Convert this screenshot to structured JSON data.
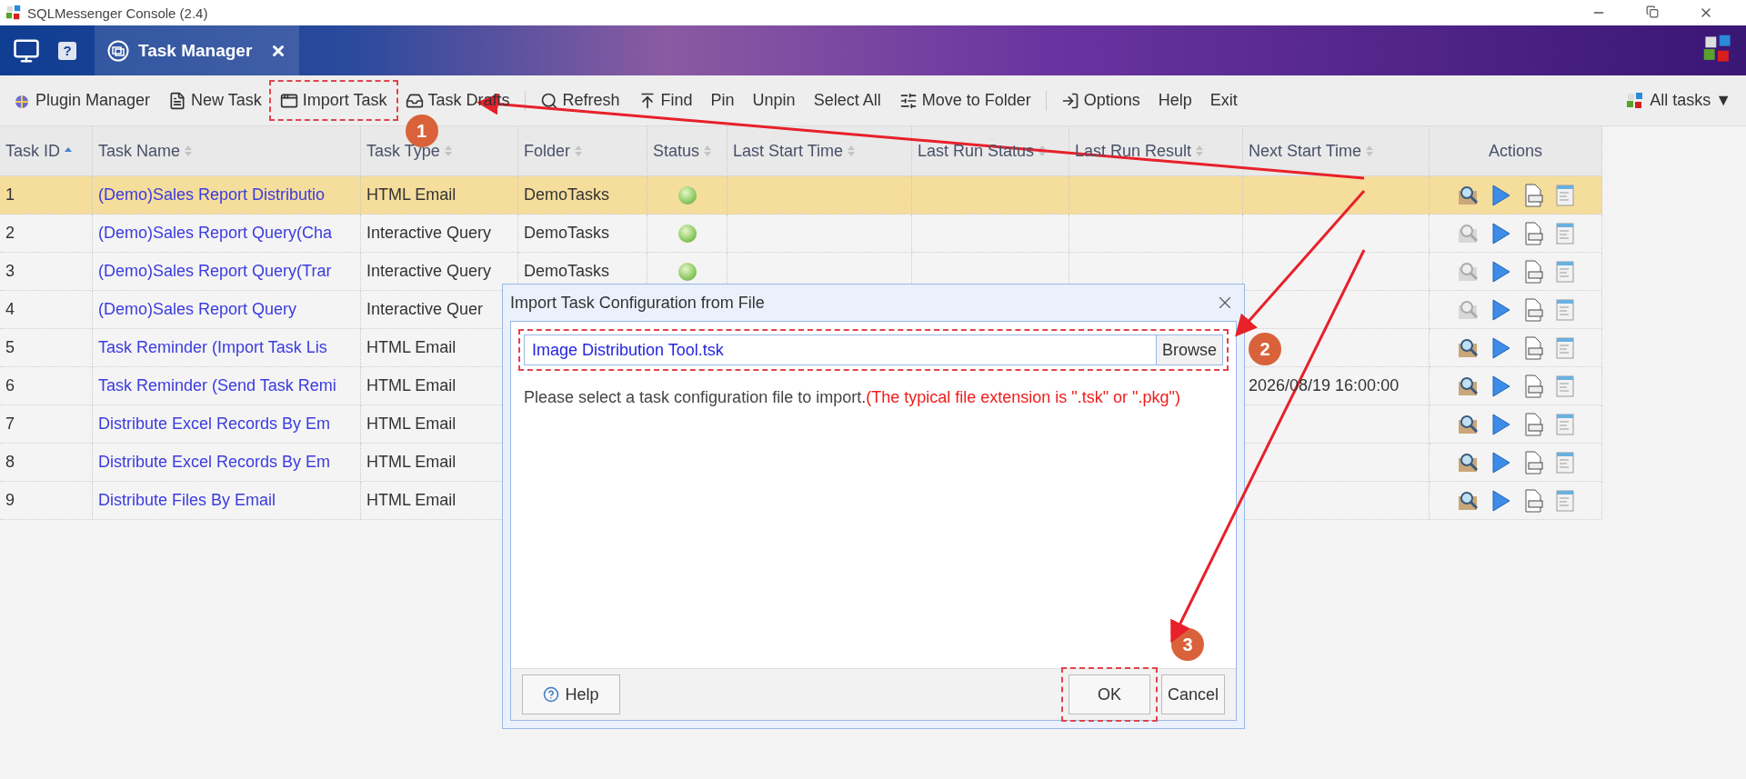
{
  "window": {
    "title": "SQLMessenger Console (2.4)"
  },
  "header": {
    "help": "?",
    "tab": {
      "label": "Task Manager",
      "selected": true
    }
  },
  "toolbar": [
    {
      "kind": "button",
      "label": "Plugin Manager"
    },
    {
      "kind": "button",
      "label": "New Task"
    },
    {
      "kind": "button",
      "label": "Import Task",
      "callout": "1"
    },
    {
      "kind": "button",
      "label": "Task Drafts"
    },
    {
      "kind": "separator"
    },
    {
      "kind": "button",
      "label": "Refresh"
    },
    {
      "kind": "button",
      "label": "Find"
    },
    {
      "kind": "button",
      "label": "Pin"
    },
    {
      "kind": "button",
      "label": "Unpin"
    },
    {
      "kind": "button",
      "label": "Select All"
    },
    {
      "kind": "button",
      "label": "Move to Folder"
    },
    {
      "kind": "separator"
    },
    {
      "kind": "button",
      "label": "Options"
    },
    {
      "kind": "button",
      "label": "Help"
    },
    {
      "kind": "button",
      "label": "Exit"
    }
  ],
  "filter": {
    "label": "All tasks ▼"
  },
  "table": {
    "columns": [
      {
        "label": "Task ID",
        "sortable": true,
        "sorted": true
      },
      {
        "label": "Task Name",
        "sortable": true,
        "sorted": false
      },
      {
        "label": "Task Type",
        "sortable": true,
        "sorted": false
      },
      {
        "label": "Folder",
        "sortable": true,
        "sorted": false
      },
      {
        "label": "Status",
        "sortable": true,
        "sorted": false
      },
      {
        "label": "Last Start Time",
        "sortable": true,
        "sorted": false
      },
      {
        "label": "Last Run Status",
        "sortable": true,
        "sorted": false
      },
      {
        "label": "Last Run Result",
        "sortable": true,
        "sorted": false
      },
      {
        "label": "Next Start Time",
        "sortable": true,
        "sorted": false
      },
      {
        "label": "Actions",
        "sortable": false
      }
    ],
    "rows": [
      {
        "id": "1",
        "name": "(Demo)Sales Report Distributio",
        "type": "HTML Email",
        "folder": "DemoTasks",
        "enabled": true,
        "selected": true,
        "preview_enabled": true
      },
      {
        "id": "2",
        "name": "(Demo)Sales Report Query(Cha",
        "type": "Interactive Query",
        "folder": "DemoTasks",
        "enabled": true,
        "selected": false,
        "preview_enabled": false
      },
      {
        "id": "3",
        "name": "(Demo)Sales Report Query(Trar",
        "type": "Interactive Query",
        "folder": "DemoTasks",
        "enabled": true,
        "selected": false,
        "preview_enabled": false
      },
      {
        "id": "4",
        "name": "(Demo)Sales Report Query",
        "type": "Interactive Quer",
        "selected": false,
        "preview_enabled": false
      },
      {
        "id": "5",
        "name": "Task Reminder (Import Task Lis",
        "type": "HTML Email",
        "selected": false,
        "preview_enabled": true
      },
      {
        "id": "6",
        "name": "Task Reminder (Send Task Remi",
        "type": "HTML Email",
        "next_start": "2026/08/19 16:00:00",
        "selected": false,
        "preview_enabled": true
      },
      {
        "id": "7",
        "name": "Distribute Excel Records By Em",
        "type": "HTML Email",
        "selected": false,
        "preview_enabled": true
      },
      {
        "id": "8",
        "name": "Distribute Excel Records By Em",
        "type": "HTML Email",
        "selected": false,
        "preview_enabled": true
      },
      {
        "id": "9",
        "name": "Distribute Files By Email",
        "type": "HTML Email",
        "selected": false,
        "preview_enabled": true
      }
    ]
  },
  "dialog": {
    "title": "Import Task Configuration from File",
    "file": {
      "value": "Image Distribution Tool.tsk",
      "callout": "2"
    },
    "browse": "Browse",
    "message": {
      "text": "Please select a task configuration file to import.",
      "note": "(The typical file extension is \".tsk\" or \".pkg\")"
    },
    "buttons": [
      {
        "kind": "help",
        "label": "Help"
      },
      {
        "kind": "primary",
        "label": "OK",
        "callout": "3"
      },
      {
        "kind": "plain",
        "label": "Cancel"
      }
    ]
  }
}
